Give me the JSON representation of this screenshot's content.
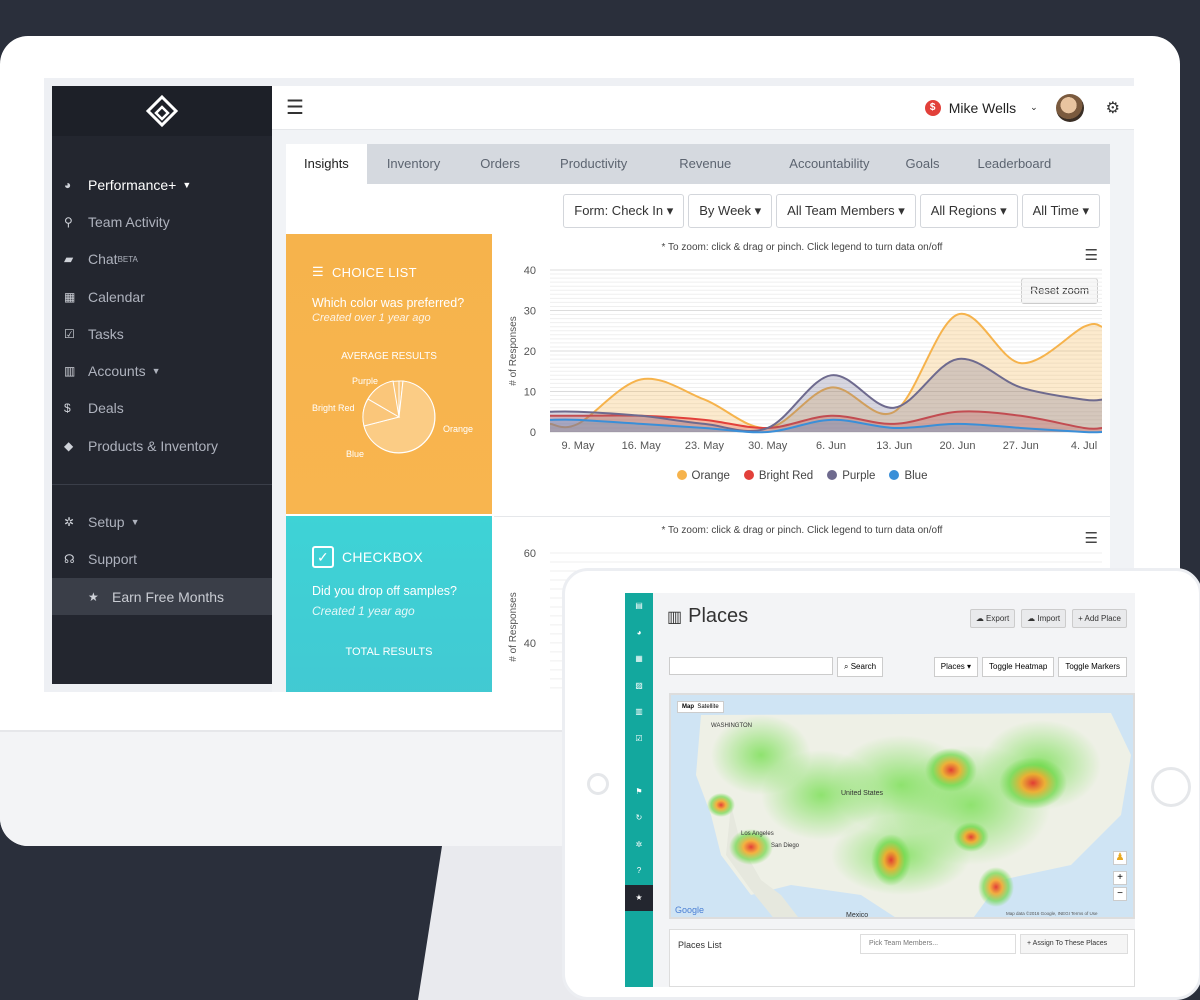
{
  "sidebar": {
    "items": [
      {
        "label": "Performance+",
        "icon": "dashboard-icon",
        "active": true,
        "caret": true
      },
      {
        "label": "Team Activity",
        "icon": "map-pin-icon"
      },
      {
        "label": "Chat",
        "sup": "BETA",
        "icon": "chat-icon"
      },
      {
        "label": "Calendar",
        "icon": "calendar-icon"
      },
      {
        "label": "Tasks",
        "icon": "checkbox-icon"
      },
      {
        "label": "Accounts",
        "icon": "briefcase-icon",
        "caret": true
      },
      {
        "label": "Deals",
        "icon": "dollar-icon"
      },
      {
        "label": "Products & Inventory",
        "icon": "tags-icon"
      }
    ],
    "bottom": [
      {
        "label": "Setup",
        "icon": "gear-icon",
        "caret": true
      },
      {
        "label": "Support",
        "icon": "headset-icon"
      }
    ],
    "earn": "Earn Free Months"
  },
  "topbar": {
    "user_name": "Mike Wells",
    "badge": "$"
  },
  "tabs": [
    "Insights",
    "Inventory",
    "Orders",
    "Productivity",
    "Revenue",
    "Accountability",
    "Goals",
    "Leaderboard"
  ],
  "filters": [
    "Form: Check In",
    "By Week",
    "All Team Members",
    "All Regions",
    "All Time"
  ],
  "card1": {
    "title": "CHOICE LIST",
    "question": "Which color was preferred?",
    "created": "Created over 1 year ago",
    "results_label": "AVERAGE RESULTS",
    "pie_labels": [
      "Purple",
      "Bright Red",
      "Blue",
      "Orange"
    ]
  },
  "card2": {
    "title": "CHECKBOX",
    "question": "Did you drop off samples?",
    "created": "Created 1 year ago",
    "results_label": "TOTAL RESULTS"
  },
  "chart_hint": "* To zoom: click & drag or pinch. Click legend to turn data on/off",
  "reset_zoom": "Reset zoom",
  "chart_data": [
    {
      "type": "area",
      "ylabel": "# of Responses",
      "ylim": [
        0,
        40
      ],
      "yticks": [
        0,
        10,
        20,
        30,
        40
      ],
      "categories": [
        "9. May",
        "16. May",
        "23. May",
        "30. May",
        "6. Jun",
        "13. Jun",
        "20. Jun",
        "27. Jun",
        "4. Jul"
      ],
      "series": [
        {
          "name": "Orange",
          "color": "#f6b34c",
          "values": [
            2,
            13,
            8,
            1,
            11,
            5,
            29,
            17,
            26
          ]
        },
        {
          "name": "Bright Red",
          "color": "#e2403a",
          "values": [
            4,
            4,
            3,
            1,
            4,
            2,
            5,
            4,
            1
          ]
        },
        {
          "name": "Purple",
          "color": "#6e6a8e",
          "values": [
            5,
            4,
            2,
            1,
            14,
            6,
            18,
            11,
            8
          ]
        },
        {
          "name": "Blue",
          "color": "#3a8fd8",
          "values": [
            3,
            2,
            1,
            0,
            3,
            1,
            2,
            1,
            0
          ]
        }
      ],
      "legend": "bottom"
    },
    {
      "type": "area",
      "ylabel": "# of Responses",
      "ylim": [
        20,
        60
      ],
      "yticks": [
        20,
        40,
        60
      ],
      "series": []
    }
  ],
  "tablet": {
    "title": "Places",
    "buttons": [
      "Export",
      "Import",
      "+ Add Place"
    ],
    "search": "Search",
    "toolbar": [
      "Places",
      "Toggle Heatmap",
      "Toggle Markers"
    ],
    "map_tabs": [
      "Map",
      "Satellite"
    ],
    "map_labels": [
      "WASHINGTON",
      "United States",
      "Los Angeles",
      "San Diego",
      "Mexico",
      "Google"
    ],
    "attribution": "Map data ©2016 Google, INEGI   Terms of Use",
    "places_list": "Places List",
    "pick_members": "Pick Team Members...",
    "assign": "+ Assign To These Places"
  }
}
